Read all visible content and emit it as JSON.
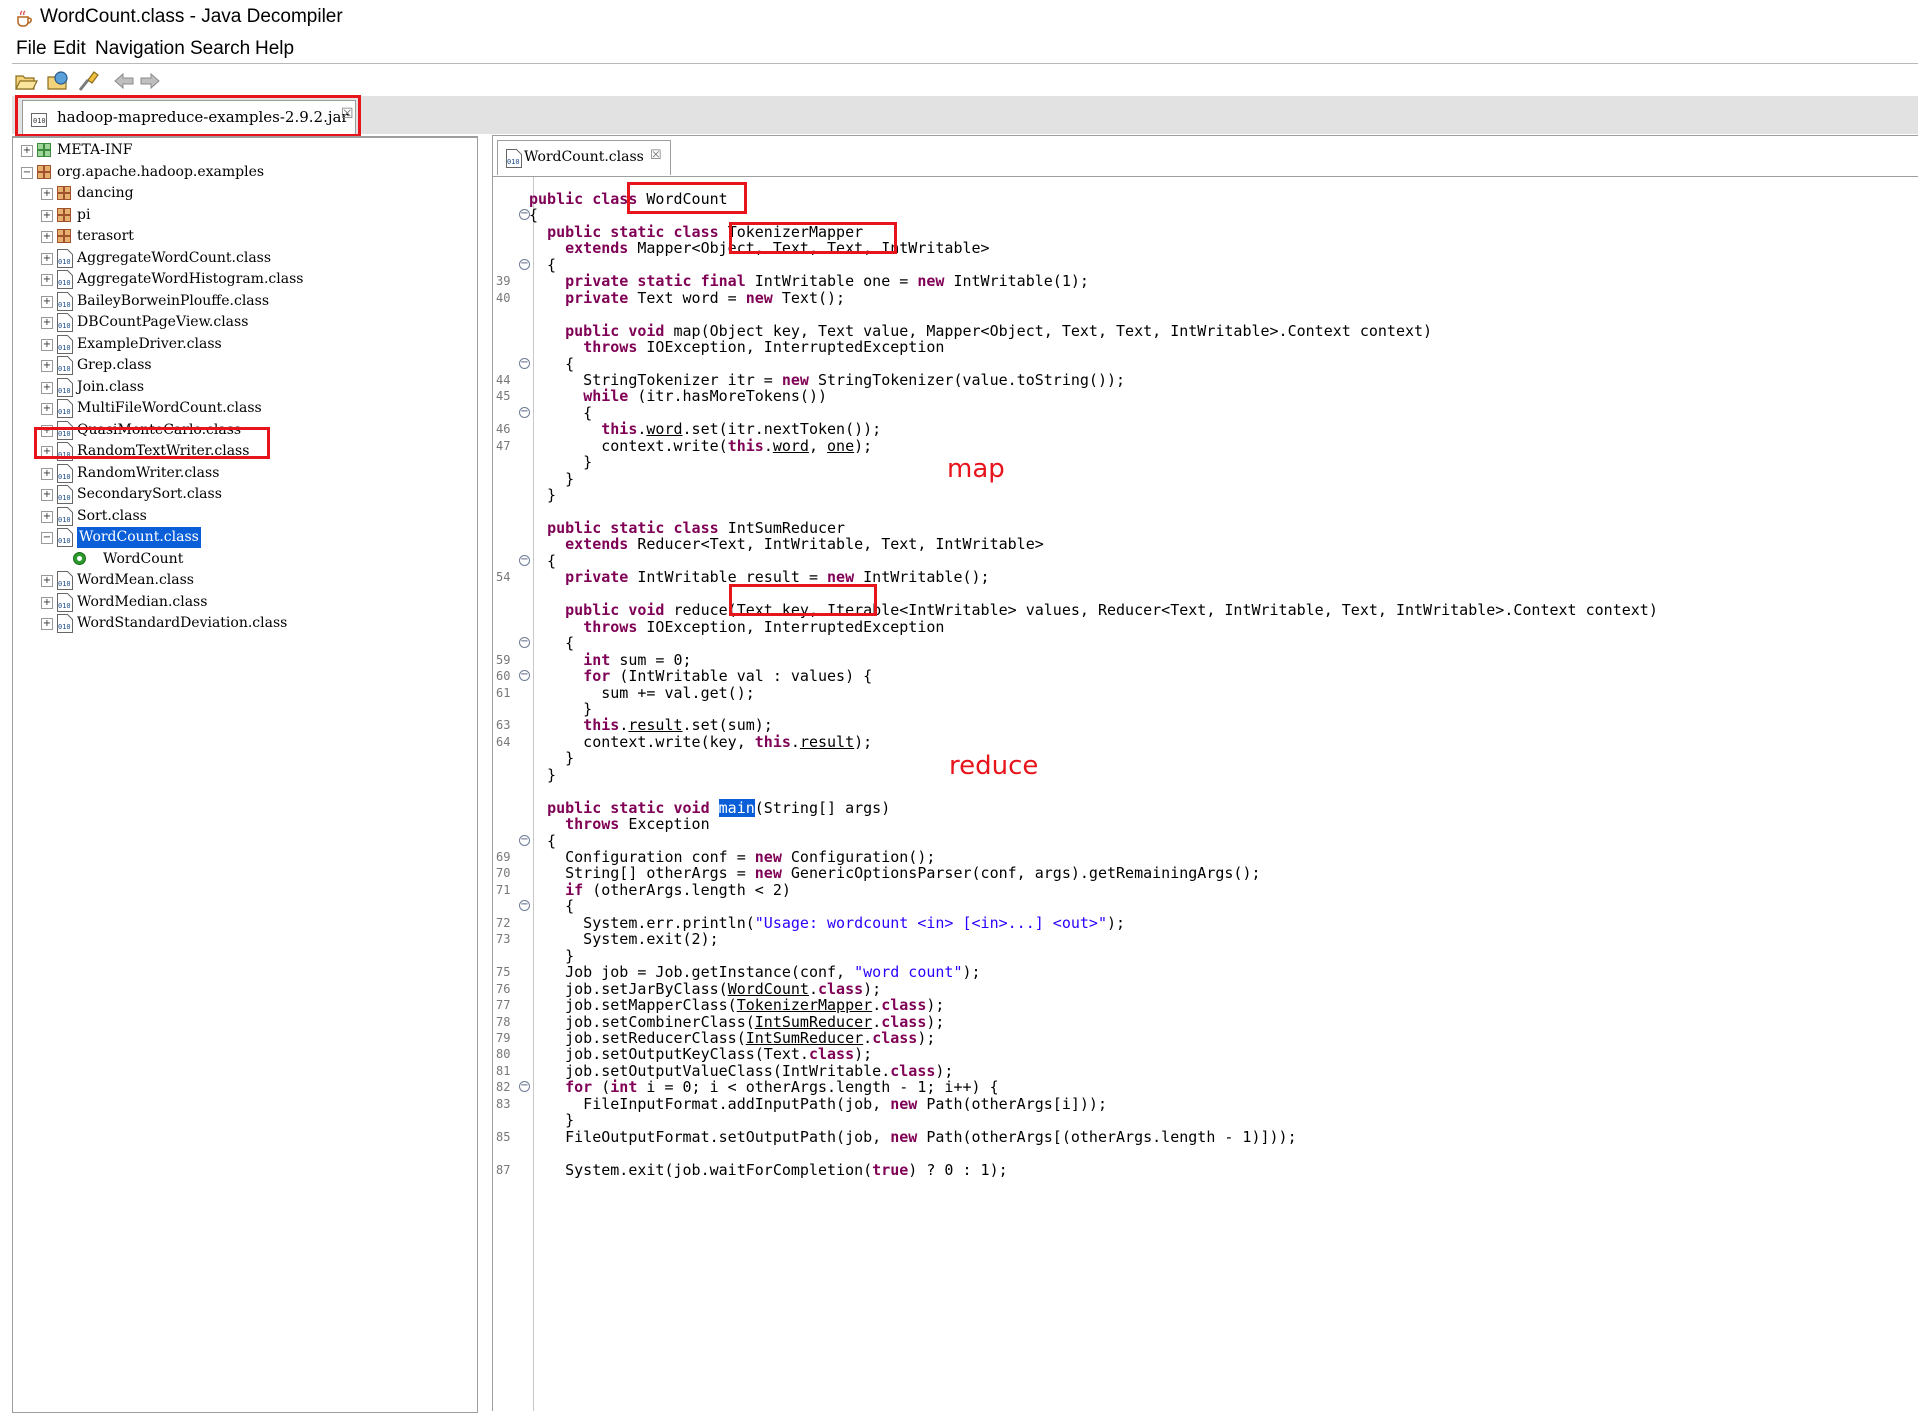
{
  "window": {
    "title": "WordCount.class - Java Decompiler",
    "icon": "java-cup-icon"
  },
  "menu": [
    "File",
    "Edit",
    "Navigation",
    "Search",
    "Help"
  ],
  "toolbar": [
    "open-file-icon",
    "open-type-icon",
    "search-icon",
    "back-icon",
    "forward-icon"
  ],
  "jar_tab": {
    "label": "hadoop-mapreduce-examples-2.9.2.jar",
    "close": "☒"
  },
  "tree": {
    "items": [
      {
        "label": "META-INF",
        "kind": "package"
      },
      {
        "label": "org.apache.hadoop.examples",
        "kind": "package"
      },
      {
        "label": "dancing",
        "kind": "package"
      },
      {
        "label": "pi",
        "kind": "package"
      },
      {
        "label": "terasort",
        "kind": "package"
      },
      {
        "label": "AggregateWordCount.class",
        "kind": "class"
      },
      {
        "label": "AggregateWordHistogram.class",
        "kind": "class"
      },
      {
        "label": "BaileyBorweinPlouffe.class",
        "kind": "class"
      },
      {
        "label": "DBCountPageView.class",
        "kind": "class"
      },
      {
        "label": "ExampleDriver.class",
        "kind": "class"
      },
      {
        "label": "Grep.class",
        "kind": "class"
      },
      {
        "label": "Join.class",
        "kind": "class"
      },
      {
        "label": "MultiFileWordCount.class",
        "kind": "class"
      },
      {
        "label": "QuasiMonteCarlo.class",
        "kind": "class"
      },
      {
        "label": "RandomTextWriter.class",
        "kind": "class"
      },
      {
        "label": "RandomWriter.class",
        "kind": "class"
      },
      {
        "label": "SecondarySort.class",
        "kind": "class"
      },
      {
        "label": "Sort.class",
        "kind": "class"
      },
      {
        "label": "WordCount.class",
        "kind": "class",
        "selected": true
      },
      {
        "label": "WordCount",
        "kind": "type"
      },
      {
        "label": "WordMean.class",
        "kind": "class"
      },
      {
        "label": "WordMedian.class",
        "kind": "class"
      },
      {
        "label": "WordStandardDeviation.class",
        "kind": "class"
      }
    ]
  },
  "editor_tab": {
    "label": "WordCount.class",
    "close": "☒"
  },
  "code": [
    {
      "n": "",
      "fold": "",
      "s": [
        [
          "kw",
          "public class "
        ],
        [
          "",
          "WordCount"
        ]
      ]
    },
    {
      "n": "",
      "fold": "⊖",
      "s": [
        [
          "",
          "{"
        ]
      ]
    },
    {
      "n": "",
      "fold": "",
      "s": [
        [
          "",
          "  "
        ],
        [
          "kw",
          "public static class "
        ],
        [
          "",
          "TokenizerMapper"
        ]
      ]
    },
    {
      "n": "",
      "fold": "",
      "s": [
        [
          "",
          "    "
        ],
        [
          "kw",
          "extends "
        ],
        [
          "",
          "Mapper<Object, Text, Text, IntWritable>"
        ]
      ]
    },
    {
      "n": "",
      "fold": "⊖",
      "s": [
        [
          "",
          "  {"
        ]
      ]
    },
    {
      "n": "39",
      "fold": "",
      "s": [
        [
          "",
          "    "
        ],
        [
          "kw",
          "private static final "
        ],
        [
          "",
          "IntWritable one = "
        ],
        [
          "kw",
          "new "
        ],
        [
          "",
          "IntWritable(1);"
        ]
      ]
    },
    {
      "n": "40",
      "fold": "",
      "s": [
        [
          "",
          "    "
        ],
        [
          "kw",
          "private "
        ],
        [
          "",
          "Text word = "
        ],
        [
          "kw",
          "new "
        ],
        [
          "",
          "Text();"
        ]
      ]
    },
    {
      "n": "",
      "fold": "",
      "s": []
    },
    {
      "n": "",
      "fold": "",
      "s": [
        [
          "",
          "    "
        ],
        [
          "kw",
          "public void "
        ],
        [
          "",
          "map(Object key, Text value, Mapper<Object, Text, Text, IntWritable>.Context context)"
        ]
      ]
    },
    {
      "n": "",
      "fold": "",
      "s": [
        [
          "",
          "      "
        ],
        [
          "kw",
          "throws "
        ],
        [
          "",
          "IOException, InterruptedException"
        ]
      ]
    },
    {
      "n": "",
      "fold": "⊖",
      "s": [
        [
          "",
          "    {"
        ]
      ]
    },
    {
      "n": "44",
      "fold": "",
      "s": [
        [
          "",
          "      StringTokenizer itr = "
        ],
        [
          "kw",
          "new "
        ],
        [
          "",
          "StringTokenizer(value.toString());"
        ]
      ]
    },
    {
      "n": "45",
      "fold": "",
      "s": [
        [
          "",
          "      "
        ],
        [
          "kw",
          "while "
        ],
        [
          "",
          "(itr.hasMoreTokens())"
        ]
      ]
    },
    {
      "n": "",
      "fold": "⊖",
      "s": [
        [
          "",
          "      {"
        ]
      ]
    },
    {
      "n": "46",
      "fold": "",
      "s": [
        [
          "",
          "        "
        ],
        [
          "kw",
          "this"
        ],
        [
          "",
          "."
        ],
        [
          "ul",
          "word"
        ],
        [
          "",
          ".set(itr.nextToken());"
        ]
      ]
    },
    {
      "n": "47",
      "fold": "",
      "s": [
        [
          "",
          "        context.write("
        ],
        [
          "kw",
          "this"
        ],
        [
          "",
          "."
        ],
        [
          "ul",
          "word"
        ],
        [
          "",
          ", "
        ],
        [
          "ul",
          "one"
        ],
        [
          "",
          ");"
        ]
      ]
    },
    {
      "n": "",
      "fold": "",
      "s": [
        [
          "",
          "      }"
        ]
      ]
    },
    {
      "n": "",
      "fold": "",
      "s": [
        [
          "",
          "    }"
        ]
      ]
    },
    {
      "n": "",
      "fold": "",
      "s": [
        [
          "",
          "  }"
        ]
      ]
    },
    {
      "n": "",
      "fold": "",
      "s": []
    },
    {
      "n": "",
      "fold": "",
      "s": [
        [
          "",
          "  "
        ],
        [
          "kw",
          "public static class "
        ],
        [
          "",
          "IntSumReducer"
        ]
      ]
    },
    {
      "n": "",
      "fold": "",
      "s": [
        [
          "",
          "    "
        ],
        [
          "kw",
          "extends "
        ],
        [
          "",
          "Reducer<Text, IntWritable, Text, IntWritable>"
        ]
      ]
    },
    {
      "n": "",
      "fold": "⊖",
      "s": [
        [
          "",
          "  {"
        ]
      ]
    },
    {
      "n": "54",
      "fold": "",
      "s": [
        [
          "",
          "    "
        ],
        [
          "kw",
          "private "
        ],
        [
          "",
          "IntWritable result = "
        ],
        [
          "kw",
          "new "
        ],
        [
          "",
          "IntWritable();"
        ]
      ]
    },
    {
      "n": "",
      "fold": "",
      "s": []
    },
    {
      "n": "",
      "fold": "",
      "s": [
        [
          "",
          "    "
        ],
        [
          "kw",
          "public void "
        ],
        [
          "",
          "reduce(Text key, Iterable<IntWritable> values, Reducer<Text, IntWritable, Text, IntWritable>.Context context)"
        ]
      ]
    },
    {
      "n": "",
      "fold": "",
      "s": [
        [
          "",
          "      "
        ],
        [
          "kw",
          "throws "
        ],
        [
          "",
          "IOException, InterruptedException"
        ]
      ]
    },
    {
      "n": "",
      "fold": "⊖",
      "s": [
        [
          "",
          "    {"
        ]
      ]
    },
    {
      "n": "59",
      "fold": "",
      "s": [
        [
          "",
          "      "
        ],
        [
          "kw",
          "int "
        ],
        [
          "",
          "sum = 0;"
        ]
      ]
    },
    {
      "n": "60",
      "fold": "⊖",
      "s": [
        [
          "",
          "      "
        ],
        [
          "kw",
          "for "
        ],
        [
          "",
          "(IntWritable val : values) {"
        ]
      ]
    },
    {
      "n": "61",
      "fold": "",
      "s": [
        [
          "",
          "        sum += val.get();"
        ]
      ]
    },
    {
      "n": "",
      "fold": "",
      "s": [
        [
          "",
          "      }"
        ]
      ]
    },
    {
      "n": "63",
      "fold": "",
      "s": [
        [
          "",
          "      "
        ],
        [
          "kw",
          "this"
        ],
        [
          "",
          "."
        ],
        [
          "ul",
          "result"
        ],
        [
          "",
          ".set(sum);"
        ]
      ]
    },
    {
      "n": "64",
      "fold": "",
      "s": [
        [
          "",
          "      context.write(key, "
        ],
        [
          "kw",
          "this"
        ],
        [
          "",
          "."
        ],
        [
          "ul",
          "result"
        ],
        [
          "",
          ");"
        ]
      ]
    },
    {
      "n": "",
      "fold": "",
      "s": [
        [
          "",
          "    }"
        ]
      ]
    },
    {
      "n": "",
      "fold": "",
      "s": [
        [
          "",
          "  }"
        ]
      ]
    },
    {
      "n": "",
      "fold": "",
      "s": []
    },
    {
      "n": "",
      "fold": "",
      "s": [
        [
          "",
          "  "
        ],
        [
          "kw",
          "public static void "
        ],
        [
          "hl",
          "main"
        ],
        [
          "",
          "(String[] args)"
        ]
      ]
    },
    {
      "n": "",
      "fold": "",
      "s": [
        [
          "",
          "    "
        ],
        [
          "kw",
          "throws "
        ],
        [
          "",
          "Exception"
        ]
      ]
    },
    {
      "n": "",
      "fold": "⊖",
      "s": [
        [
          "",
          "  {"
        ]
      ]
    },
    {
      "n": "69",
      "fold": "",
      "s": [
        [
          "",
          "    Configuration conf = "
        ],
        [
          "kw",
          "new "
        ],
        [
          "",
          "Configuration();"
        ]
      ]
    },
    {
      "n": "70",
      "fold": "",
      "s": [
        [
          "",
          "    String[] otherArgs = "
        ],
        [
          "kw",
          "new "
        ],
        [
          "",
          "GenericOptionsParser(conf, args).getRemainingArgs();"
        ]
      ]
    },
    {
      "n": "71",
      "fold": "",
      "s": [
        [
          "",
          "    "
        ],
        [
          "kw",
          "if "
        ],
        [
          "",
          "(otherArgs.length < 2)"
        ]
      ]
    },
    {
      "n": "",
      "fold": "⊖",
      "s": [
        [
          "",
          "    {"
        ]
      ]
    },
    {
      "n": "72",
      "fold": "",
      "s": [
        [
          "",
          "      System.err.println("
        ],
        [
          "str",
          "\"Usage: wordcount <in> [<in>...] <out>\""
        ],
        [
          "",
          ");"
        ]
      ]
    },
    {
      "n": "73",
      "fold": "",
      "s": [
        [
          "",
          "      System.exit(2);"
        ]
      ]
    },
    {
      "n": "",
      "fold": "",
      "s": [
        [
          "",
          "    }"
        ]
      ]
    },
    {
      "n": "75",
      "fold": "",
      "s": [
        [
          "",
          "    Job job = Job.getInstance(conf, "
        ],
        [
          "str",
          "\"word count\""
        ],
        [
          "",
          ");"
        ]
      ]
    },
    {
      "n": "76",
      "fold": "",
      "s": [
        [
          "",
          "    job.setJarByClass("
        ],
        [
          "ul",
          "WordCount"
        ],
        [
          "",
          "."
        ],
        [
          "kw",
          "class"
        ],
        [
          "",
          ");"
        ]
      ]
    },
    {
      "n": "77",
      "fold": "",
      "s": [
        [
          "",
          "    job.setMapperClass("
        ],
        [
          "ul",
          "TokenizerMapper"
        ],
        [
          "",
          "."
        ],
        [
          "kw",
          "class"
        ],
        [
          "",
          ");"
        ]
      ]
    },
    {
      "n": "78",
      "fold": "",
      "s": [
        [
          "",
          "    job.setCombinerClass("
        ],
        [
          "ul",
          "IntSumReducer"
        ],
        [
          "",
          "."
        ],
        [
          "kw",
          "class"
        ],
        [
          "",
          ");"
        ]
      ]
    },
    {
      "n": "79",
      "fold": "",
      "s": [
        [
          "",
          "    job.setReducerClass("
        ],
        [
          "ul",
          "IntSumReducer"
        ],
        [
          "",
          "."
        ],
        [
          "kw",
          "class"
        ],
        [
          "",
          ");"
        ]
      ]
    },
    {
      "n": "80",
      "fold": "",
      "s": [
        [
          "",
          "    job.setOutputKeyClass(Text."
        ],
        [
          "kw",
          "class"
        ],
        [
          "",
          ");"
        ]
      ]
    },
    {
      "n": "81",
      "fold": "",
      "s": [
        [
          "",
          "    job.setOutputValueClass(IntWritable."
        ],
        [
          "kw",
          "class"
        ],
        [
          "",
          ");"
        ]
      ]
    },
    {
      "n": "82",
      "fold": "⊖",
      "s": [
        [
          "",
          "    "
        ],
        [
          "kw",
          "for "
        ],
        [
          "",
          "("
        ],
        [
          "kw",
          "int "
        ],
        [
          "",
          "i = 0; i < otherArgs.length - 1; i++) {"
        ]
      ]
    },
    {
      "n": "83",
      "fold": "",
      "s": [
        [
          "",
          "      FileInputFormat.addInputPath(job, "
        ],
        [
          "kw",
          "new "
        ],
        [
          "",
          "Path(otherArgs[i]));"
        ]
      ]
    },
    {
      "n": "",
      "fold": "",
      "s": [
        [
          "",
          "    }"
        ]
      ]
    },
    {
      "n": "85",
      "fold": "",
      "s": [
        [
          "",
          "    FileOutputFormat.setOutputPath(job, "
        ],
        [
          "kw",
          "new "
        ],
        [
          "",
          "Path(otherArgs[(otherArgs.length - 1)]));"
        ]
      ]
    },
    {
      "n": "",
      "fold": "",
      "s": []
    },
    {
      "n": "87",
      "fold": "",
      "s": [
        [
          "",
          "    System.exit(job.waitForCompletion("
        ],
        [
          "kw",
          "true"
        ],
        [
          "",
          ") ? 0 : 1);"
        ]
      ]
    }
  ],
  "annotations": {
    "map": "map",
    "reduce": "reduce"
  },
  "colors": {
    "keyword": "#7f0055",
    "string": "#2a00ff",
    "selection": "#0a5fd8",
    "callout": "#e8141c"
  }
}
